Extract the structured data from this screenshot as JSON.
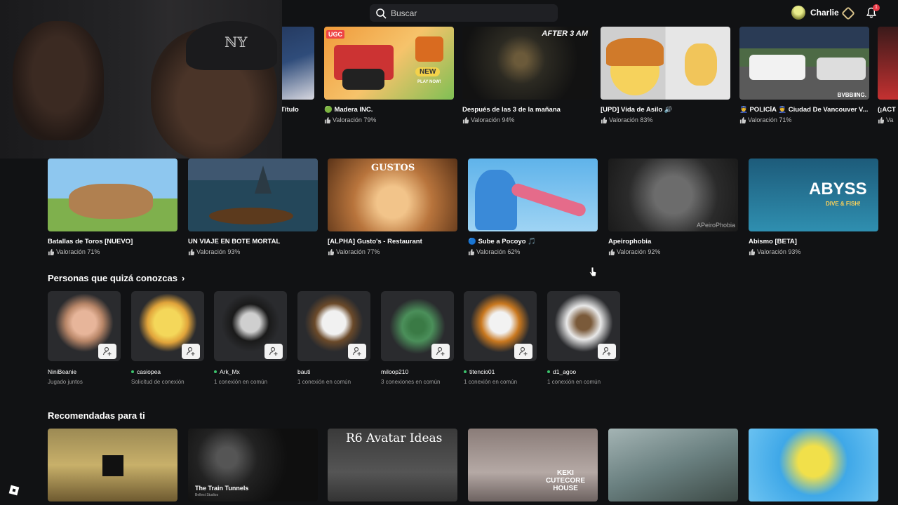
{
  "header": {
    "search_placeholder": "Buscar",
    "username": "Charlie",
    "notification_count": "1"
  },
  "top_row": [
    {
      "title": "Título",
      "rating": ""
    },
    {
      "title": "🟢 Madera INC.",
      "rating": "Valoración 79%",
      "badge": "UGC",
      "tag": "NEW",
      "sub": "PLAY NOW!"
    },
    {
      "title": "Después de las 3 de la mañana",
      "rating": "Valoración 94%",
      "overlay": "AFTER 3 AM"
    },
    {
      "title": "[UPD] Vida de Asilo 🔊",
      "rating": "Valoración 83%"
    },
    {
      "title": "👮 POLICÍA 👮 Ciudad De Vancouver V...",
      "rating": "Valoración 71%",
      "overlay": "BVBBIING."
    },
    {
      "title": "(¡ACT",
      "rating": "Va"
    }
  ],
  "second_row": [
    {
      "title": "Batallas de Toros [NUEVO]",
      "rating": "Valoración 71%"
    },
    {
      "title": "UN VIAJE EN BOTE MORTAL",
      "rating": "Valoración 93%"
    },
    {
      "title": "[ALPHA] Gusto's - Restaurant",
      "rating": "Valoración 77%",
      "overlay": "GUSTOS"
    },
    {
      "title": "🔵 Sube a Pocoyo 🎵",
      "rating": "Valoración 62%"
    },
    {
      "title": "Apeirophobia",
      "rating": "Valoración 92%",
      "overlay": "APeiroPhobia"
    },
    {
      "title": "Abismo [BETA]",
      "rating": "Valoración 93%",
      "overlay": "ABYSS",
      "overlay2": "DIVE & FISH!"
    }
  ],
  "people_section": {
    "title": "Personas que quizá conozcas",
    "people": [
      {
        "name": "NiniBeanie",
        "status": "Jugado juntos",
        "online": false
      },
      {
        "name": "casiopea",
        "status": "Solicitud de conexión",
        "online": true
      },
      {
        "name": "Ark_Mx",
        "status": "1 conexión en común",
        "online": true
      },
      {
        "name": "bauti",
        "status": "1 conexión en común",
        "online": false
      },
      {
        "name": "miloop210",
        "status": "3 conexiones en común",
        "online": false
      },
      {
        "name": "titencio01",
        "status": "1 conexión en común",
        "online": true
      },
      {
        "name": "d1_agoo",
        "status": "1 conexión en común",
        "online": true
      }
    ]
  },
  "recommended_section": {
    "title": "Recomendadas para ti",
    "tiles": [
      {
        "overlay": ""
      },
      {
        "overlay": "The Train Tunnels",
        "sub": "Bellest Studios"
      },
      {
        "overlay": "R6 Avatar Ideas"
      },
      {
        "overlay": "KEKI CUTECORE HOUSE"
      },
      {
        "overlay": ""
      },
      {
        "overlay": ""
      }
    ]
  },
  "colors": {
    "background": "#111214",
    "search_bg": "#1f2024",
    "online": "#3cc36c",
    "badge": "#e63946"
  }
}
